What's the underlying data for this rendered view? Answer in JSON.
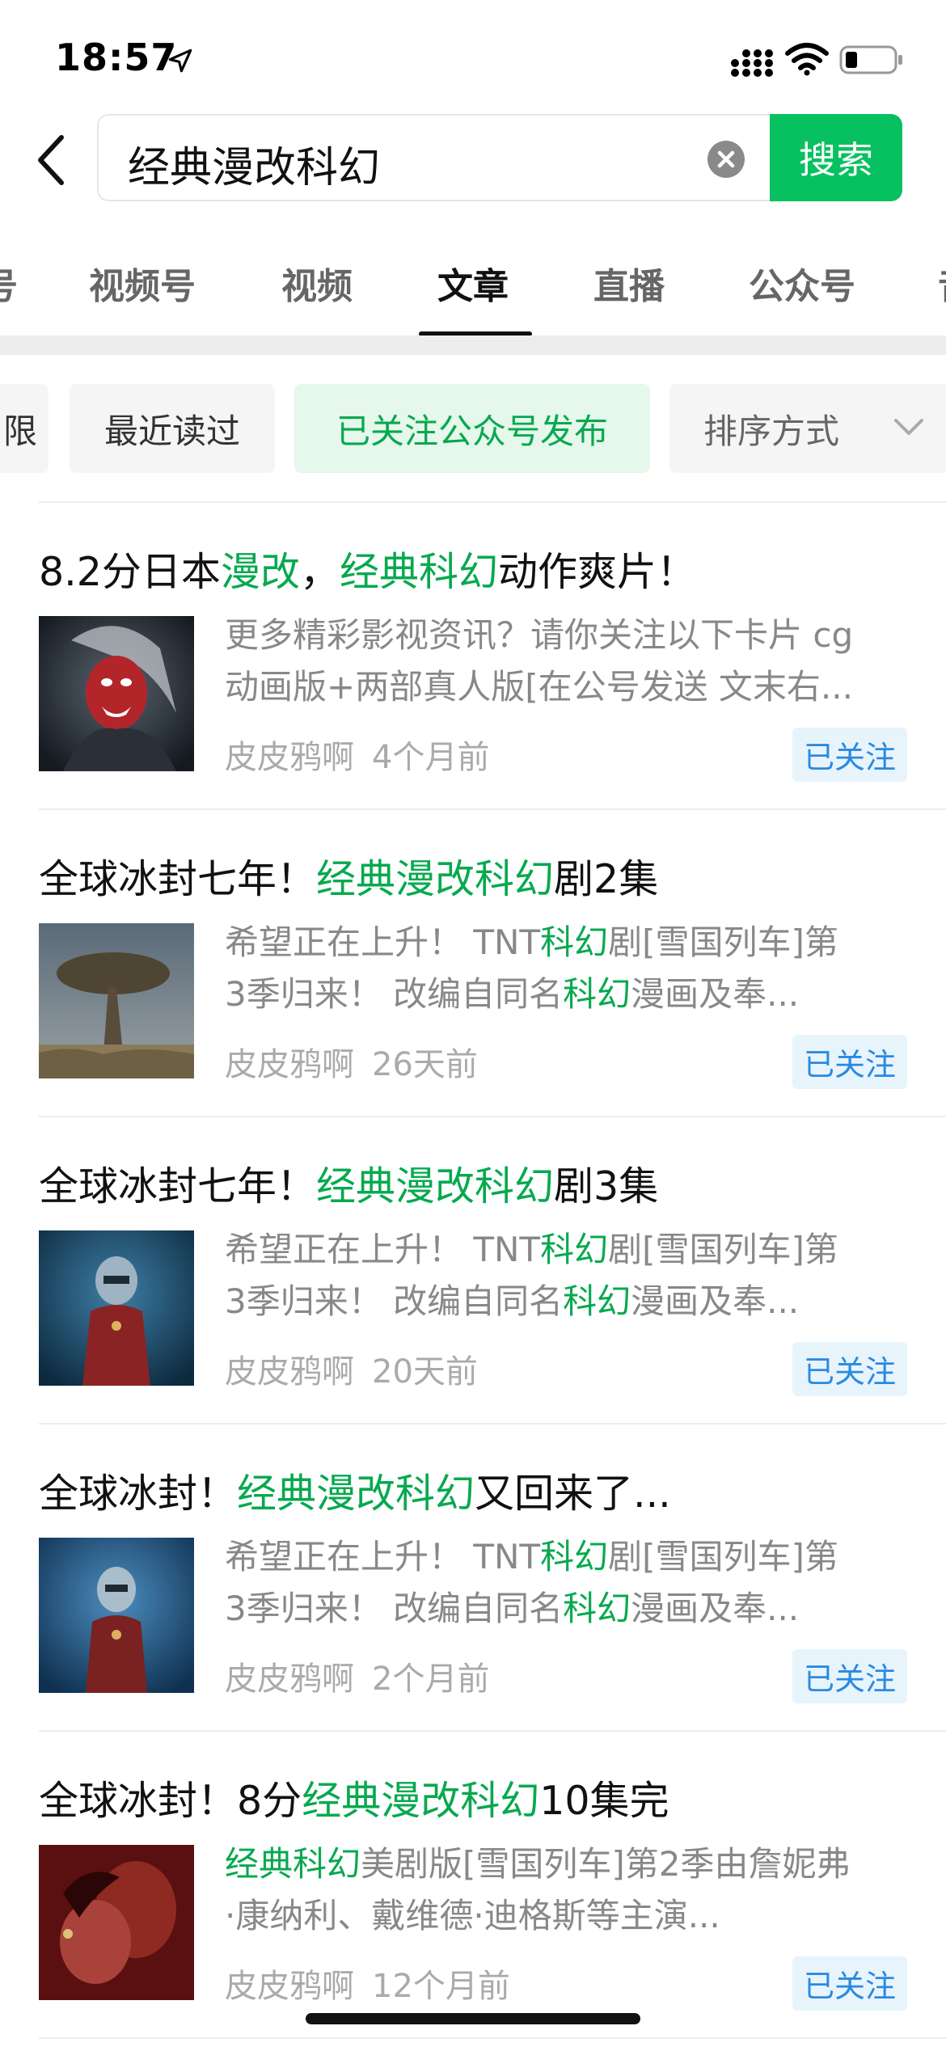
{
  "status_bar": {
    "time": "18:57"
  },
  "search": {
    "query": "经典漫改科幻",
    "button_label": "搜索"
  },
  "tabs": [
    {
      "label": "号"
    },
    {
      "label": "视频号"
    },
    {
      "label": "视频"
    },
    {
      "label": "文章",
      "active": true
    },
    {
      "label": "直播"
    },
    {
      "label": "公众号"
    },
    {
      "label": "音"
    }
  ],
  "filters": {
    "partial_label": "限",
    "recent_label": "最近读过",
    "followed_label": "已关注公众号发布",
    "sort_label": "排序方式"
  },
  "articles": [
    {
      "title": [
        {
          "t": "8.2分日本"
        },
        {
          "t": "漫改",
          "hl": true
        },
        {
          "t": "，"
        },
        {
          "t": "经典科幻",
          "hl": true
        },
        {
          "t": "动作爽片！"
        }
      ],
      "desc_line1": [
        {
          "t": "更多精彩影视资讯？请你关注以下卡片 cg"
        }
      ],
      "desc_line2": [
        {
          "t": "动画版+两部真人版[在公号发送 文末右..."
        }
      ],
      "author": "皮皮鸦啊",
      "time": "4个月前",
      "badge": "已关注",
      "thumb": "red-masked-creature"
    },
    {
      "title": [
        {
          "t": "全球冰封七年！"
        },
        {
          "t": "经典漫改科幻",
          "hl": true
        },
        {
          "t": "剧2集"
        }
      ],
      "desc_line1": [
        {
          "t": "希望正在上升！ TNT"
        },
        {
          "t": "科幻",
          "hl": true
        },
        {
          "t": "剧[雪国列车]第"
        }
      ],
      "desc_line2": [
        {
          "t": "3季归来！ 改编自同名"
        },
        {
          "t": "科幻",
          "hl": true
        },
        {
          "t": "漫画及奉..."
        }
      ],
      "author": "皮皮鸦啊",
      "time": "26天前",
      "badge": "已关注",
      "thumb": "dragon-tree"
    },
    {
      "title": [
        {
          "t": "全球冰封七年！"
        },
        {
          "t": "经典漫改科幻",
          "hl": true
        },
        {
          "t": "剧3集"
        }
      ],
      "desc_line1": [
        {
          "t": "希望正在上升！ TNT"
        },
        {
          "t": "科幻",
          "hl": true
        },
        {
          "t": "剧[雪国列车]第"
        }
      ],
      "desc_line2": [
        {
          "t": "3季归来！ 改编自同名"
        },
        {
          "t": "科幻",
          "hl": true
        },
        {
          "t": "漫画及奉..."
        }
      ],
      "author": "皮皮鸦啊",
      "time": "20天前",
      "badge": "已关注",
      "thumb": "suited-figure"
    },
    {
      "title": [
        {
          "t": "全球冰封！"
        },
        {
          "t": "经典漫改科幻",
          "hl": true
        },
        {
          "t": "又回来了..."
        }
      ],
      "desc_line1": [
        {
          "t": "希望正在上升！ TNT"
        },
        {
          "t": "科幻",
          "hl": true
        },
        {
          "t": "剧[雪国列车]第"
        }
      ],
      "desc_line2": [
        {
          "t": "3季归来！ 改编自同名"
        },
        {
          "t": "科幻",
          "hl": true
        },
        {
          "t": "漫画及奉..."
        }
      ],
      "author": "皮皮鸦啊",
      "time": "2个月前",
      "badge": "已关注",
      "thumb": "suited-figure-blue"
    },
    {
      "title": [
        {
          "t": "全球冰封！8分"
        },
        {
          "t": "经典漫改科幻",
          "hl": true
        },
        {
          "t": "10集完"
        }
      ],
      "desc_line1": [
        {
          "t": "经典科幻",
          "hl": true
        },
        {
          "t": "美剧版[雪国列车]第2季由詹妮弗"
        }
      ],
      "desc_line2": [
        {
          "t": "·康纳利、戴维德·迪格斯等主演..."
        }
      ],
      "author": "皮皮鸦啊",
      "time": "12个月前",
      "badge": "已关注",
      "thumb": "red-portrait"
    }
  ],
  "colors": {
    "brand_green": "#07c160",
    "highlight_green": "#07a94f",
    "follow_blue": "#2a8ae0",
    "follow_bg": "#e8f4fc"
  }
}
